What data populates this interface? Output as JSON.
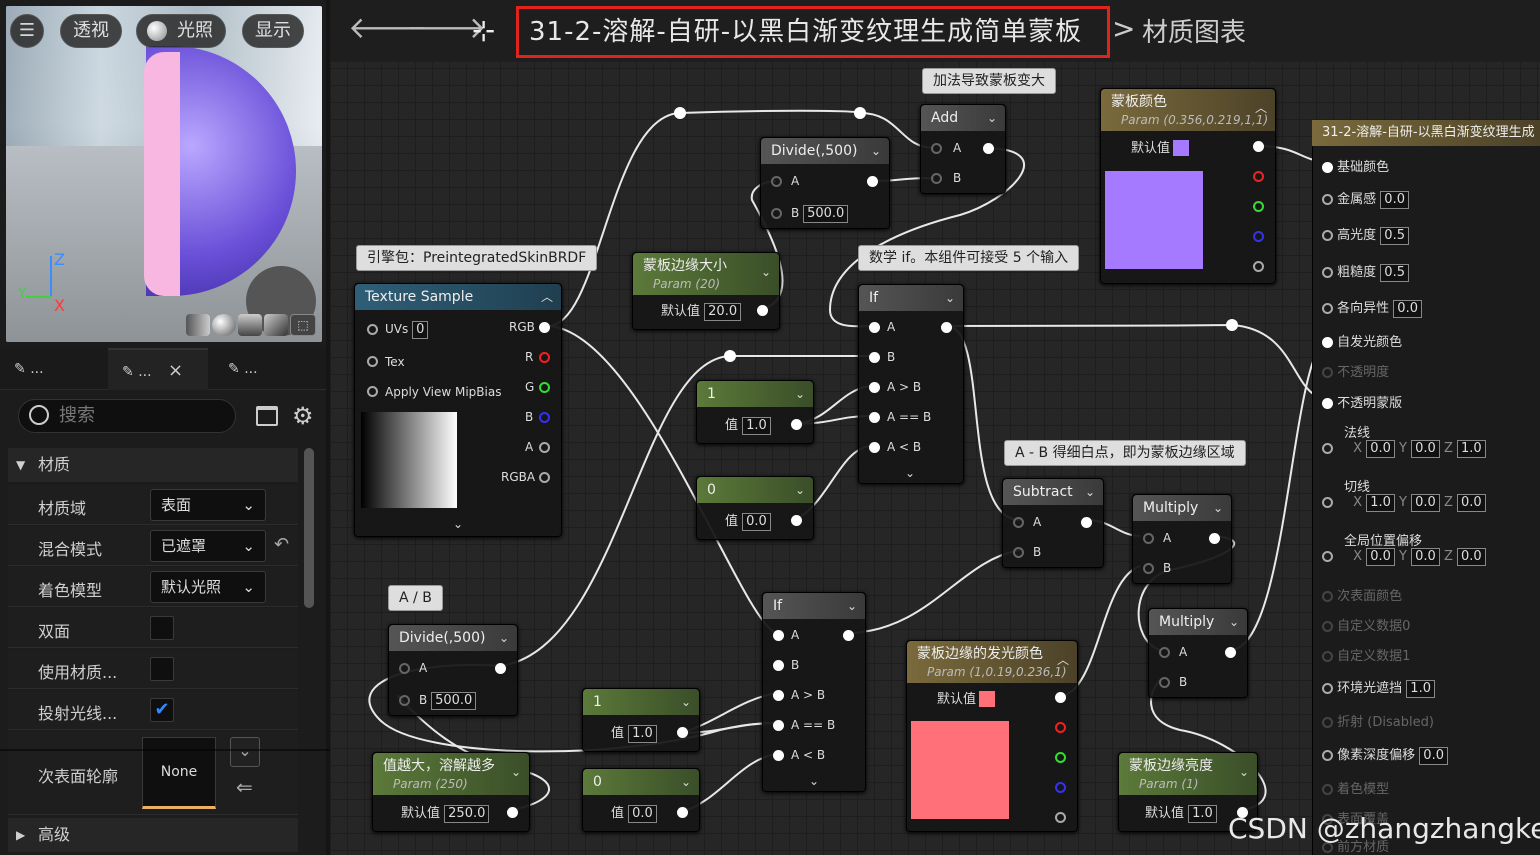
{
  "viewport": {
    "menu_icon": "hamburger-icon",
    "buttons": [
      "透视",
      "光照",
      "显示"
    ],
    "axes": {
      "z": "Z",
      "y": "Y",
      "x": "X"
    }
  },
  "details_tabs": [
    {
      "label": "..."
    },
    {
      "label": "...",
      "close": "×"
    },
    {
      "label": "..."
    }
  ],
  "search": {
    "placeholder": "搜索"
  },
  "material_section": {
    "title": "材质",
    "rows": [
      {
        "label": "材质域",
        "value": "表面"
      },
      {
        "label": "混合模式",
        "value": "已遮罩"
      },
      {
        "label": "着色模型",
        "value": "默认光照"
      },
      {
        "label": "双面",
        "checked": false
      },
      {
        "label": "使用材质...",
        "checked": false
      },
      {
        "label": "投射光线...",
        "checked": true
      },
      {
        "label": "次表面轮廓",
        "value": "None"
      }
    ],
    "advanced": "高级"
  },
  "breadcrumb": {
    "title": "31-2-溶解-自研-以黑白渐变纹理生成简单蒙板",
    "separator": ">",
    "section": "材质图表"
  },
  "comments": {
    "engine_pack": "引擎包：PreintegratedSkinBRDF",
    "add_note": "加法导致蒙板变大",
    "if_note": "数学 if。本组件可接受 5 个输入",
    "subtract_note": "A - B 得细白点，即为蒙板边缘区域",
    "ab_note": "A / B"
  },
  "nodes": {
    "texture_sample": {
      "title": "Texture Sample",
      "uvs": "UVs",
      "uvs_val": "0",
      "tex": "Tex",
      "mip": "Apply View MipBias",
      "outs": [
        "RGB",
        "R",
        "G",
        "B",
        "A",
        "RGBA"
      ]
    },
    "divide_top": {
      "title": "Divide(,500)",
      "a": "A",
      "b": "B",
      "b_val": "500.0"
    },
    "add": {
      "title": "Add",
      "a": "A",
      "b": "B"
    },
    "mask_color": {
      "title": "蒙板颜色",
      "param": "Param (0.356,0.219,1,1)",
      "default_label": "默认值",
      "swatch": "#a57aff"
    },
    "edge_size": {
      "title": "蒙板边缘大小",
      "param": "Param (20)",
      "default_label": "默认值",
      "default_val": "20.0"
    },
    "if_top": {
      "title": "If",
      "pins": [
        "A",
        "B",
        "A > B",
        "A == B",
        "A < B"
      ]
    },
    "const_1_top": {
      "title": "1",
      "label": "值",
      "val": "1.0"
    },
    "const_0_top": {
      "title": "0",
      "label": "值",
      "val": "0.0"
    },
    "subtract": {
      "title": "Subtract",
      "a": "A",
      "b": "B"
    },
    "multiply_1": {
      "title": "Multiply",
      "a": "A",
      "b": "B"
    },
    "multiply_2": {
      "title": "Multiply",
      "a": "A",
      "b": "B"
    },
    "divide_bottom": {
      "title": "Divide(,500)",
      "a": "A",
      "b": "B",
      "b_val": "500.0"
    },
    "if_bottom": {
      "title": "If",
      "pins": [
        "A",
        "B",
        "A > B",
        "A == B",
        "A < B"
      ]
    },
    "const_1_bottom": {
      "title": "1",
      "label": "值",
      "val": "1.0"
    },
    "const_0_bottom": {
      "title": "0",
      "label": "值",
      "val": "0.0"
    },
    "dissolve_value": {
      "title": "值越大，溶解越多",
      "param": "Param (250)",
      "default_label": "默认值",
      "default_val": "250.0"
    },
    "edge_glow": {
      "title": "蒙板边缘的发光颜色",
      "param": "Param (1,0.19,0.236,1)",
      "default_label": "默认值",
      "swatch": "#ff7078"
    },
    "edge_brightness": {
      "title": "蒙板边缘亮度",
      "param": "Param (1)",
      "default_label": "默认值",
      "default_val": "1.0"
    }
  },
  "result_node": {
    "title": "31-2-溶解-自研-以黑白渐变纹理生成",
    "inputs": [
      {
        "label": "基础颜色",
        "enabled": true
      },
      {
        "label": "金属感",
        "val": "0.0",
        "enabled": true
      },
      {
        "label": "高光度",
        "val": "0.5",
        "enabled": true
      },
      {
        "label": "粗糙度",
        "val": "0.5",
        "enabled": true
      },
      {
        "label": "各向异性",
        "val": "0.0",
        "enabled": true
      },
      {
        "label": "自发光颜色",
        "enabled": true
      },
      {
        "label": "不透明度",
        "enabled": false
      },
      {
        "label": "不透明蒙版",
        "enabled": true
      },
      {
        "label": "法线",
        "x": "0.0",
        "y": "0.0",
        "z": "1.0",
        "enabled": true
      },
      {
        "label": "切线",
        "x": "1.0",
        "y": "0.0",
        "z": "0.0",
        "enabled": true
      },
      {
        "label": "全局位置偏移",
        "x": "0.0",
        "y": "0.0",
        "z": "0.0",
        "enabled": true
      },
      {
        "label": "次表面颜色",
        "enabled": false
      },
      {
        "label": "自定义数据0",
        "enabled": false
      },
      {
        "label": "自定义数据1",
        "enabled": false
      },
      {
        "label": "环境光遮挡",
        "val": "1.0",
        "enabled": true
      },
      {
        "label": "折射 (Disabled)",
        "enabled": false
      },
      {
        "label": "像素深度偏移",
        "val": "0.0",
        "enabled": true
      },
      {
        "label": "着色模型",
        "enabled": false
      },
      {
        "label": "表面覆盖",
        "enabled": false
      },
      {
        "label": "前方材质",
        "enabled": false
      }
    ],
    "xyz_labels": {
      "x": "X",
      "y": "Y",
      "z": "Z"
    }
  },
  "watermark": "CSDN @zhangzhangkeji"
}
